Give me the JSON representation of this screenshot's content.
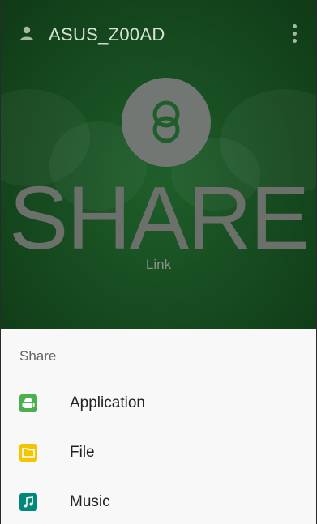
{
  "header": {
    "device_name": "ASUS_Z00AD",
    "user_icon": "person-icon",
    "menu_icon": "more-vert-icon"
  },
  "hero": {
    "logo_icon": "share-link-logo-icon",
    "title": "SHARE",
    "subtitle": "Link"
  },
  "sheet": {
    "title": "Share",
    "options": [
      {
        "label": "Application",
        "icon": "android-app-icon",
        "color": "#4caf50"
      },
      {
        "label": "File",
        "icon": "folder-icon",
        "color": "#f5c400"
      },
      {
        "label": "Music",
        "icon": "music-note-icon",
        "color": "#00897b"
      }
    ]
  },
  "colors": {
    "hero_background": "#164a1f",
    "logo_circle": "#727773",
    "sheet_background": "#f8f8f8"
  }
}
